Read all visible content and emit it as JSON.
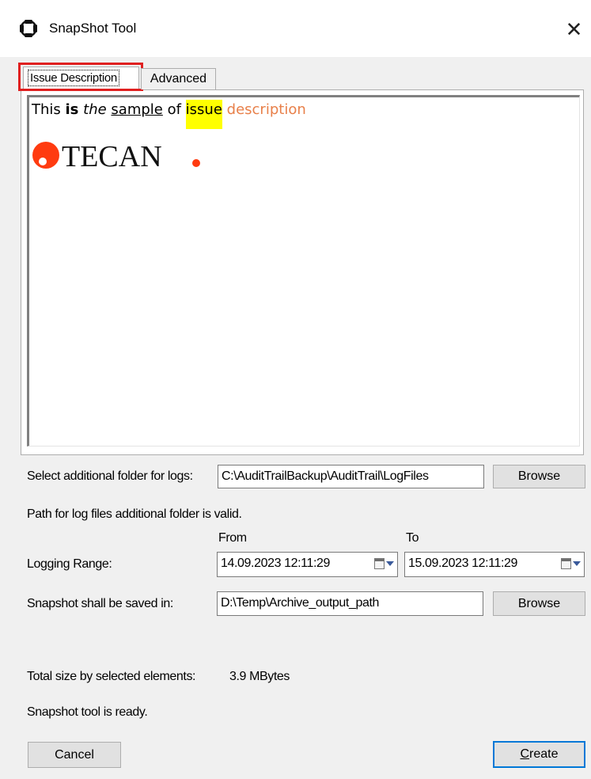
{
  "window": {
    "title": "SnapShot Tool",
    "close_glyph": "✕"
  },
  "tabs": [
    {
      "label": "Issue Description",
      "selected": true
    },
    {
      "label": "Advanced",
      "selected": false
    }
  ],
  "editor": {
    "runs": [
      {
        "text": "This ",
        "style": "normal"
      },
      {
        "text": "is",
        "style": "bold"
      },
      {
        "text": " ",
        "style": "normal"
      },
      {
        "text": "the",
        "style": "italic"
      },
      {
        "text": " ",
        "style": "normal"
      },
      {
        "text": "sample",
        "style": "underline"
      },
      {
        "text": " of ",
        "style": "normal"
      },
      {
        "text": "issue",
        "style": "highlight",
        "color": "#ffff00"
      },
      {
        "text": " ",
        "style": "normal"
      },
      {
        "text": "description",
        "style": "colored",
        "color": "#e8804a"
      }
    ],
    "logo_text": "TECAN",
    "logo_color": "#ff3b10"
  },
  "logs_folder": {
    "label": "Select additional folder for logs:",
    "value": "C:\\AuditTrailBackup\\AuditTrail\\LogFiles",
    "browse_label": "Browse",
    "status": "Path for log files additional folder is valid."
  },
  "logging_range": {
    "label": "Logging Range:",
    "from_label": "From",
    "to_label": "To",
    "from_value": "14.09.2023 12:11:29",
    "to_value": "15.09.2023 12:11:29",
    "picker_icon": "calendar-dropdown-icon"
  },
  "save_path": {
    "label": "Snapshot shall be saved in:",
    "value": "D:\\Temp\\Archive_output_path",
    "browse_label": "Browse"
  },
  "size_info": {
    "label": "Total size by selected elements:",
    "value": "3.9 MBytes"
  },
  "status_message": "Snapshot tool is ready.",
  "buttons": {
    "cancel": "Cancel",
    "create_accel": "C",
    "create_rest": "reate"
  },
  "colors": {
    "accent": "#0078d7",
    "highlight_box": "#e02020",
    "window_bg": "#f0f0f0"
  }
}
